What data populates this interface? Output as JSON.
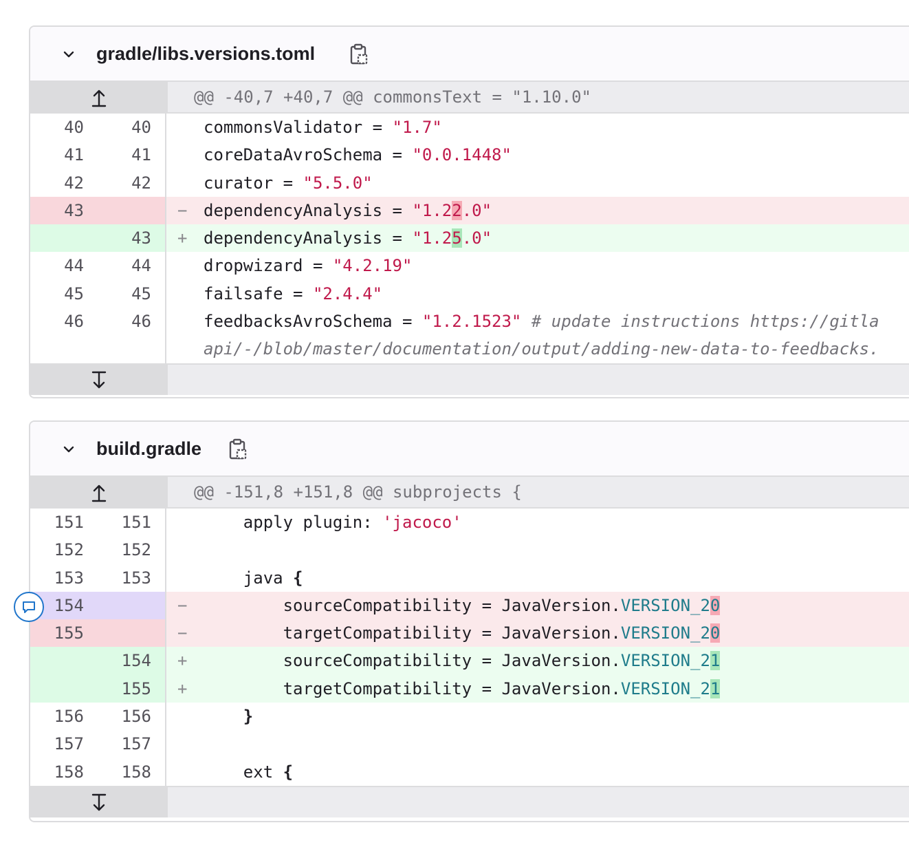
{
  "files": [
    {
      "path": "gradle/libs.versions.toml",
      "hunk_header": "@@ -40,7 +40,7 @@ commonsText = \"1.10.0\"",
      "lines": [
        {
          "old": "40",
          "new": "40",
          "sign": "",
          "key": "commonsValidator = ",
          "val": "\"1.7\""
        },
        {
          "old": "41",
          "new": "41",
          "sign": "",
          "key": "coreDataAvroSchema = ",
          "val": "\"0.0.1448\""
        },
        {
          "old": "42",
          "new": "42",
          "sign": "",
          "key": "curator = ",
          "val": "\"5.5.0\""
        },
        {
          "old": "43",
          "new": "",
          "sign": "−",
          "key": "dependencyAnalysis = ",
          "val_a": "\"1.2",
          "val_hl": "2",
          "val_b": ".0\""
        },
        {
          "old": "",
          "new": "43",
          "sign": "+",
          "key": "dependencyAnalysis = ",
          "val_a": "\"1.2",
          "val_hl": "5",
          "val_b": ".0\""
        },
        {
          "old": "44",
          "new": "44",
          "sign": "",
          "key": "dropwizard = ",
          "val": "\"4.2.19\""
        },
        {
          "old": "45",
          "new": "45",
          "sign": "",
          "key": "failsafe = ",
          "val": "\"2.4.4\""
        },
        {
          "old": "46",
          "new": "46",
          "sign": "",
          "key": "feedbacksAvroSchema = ",
          "val": "\"1.2.1523\"",
          "comment": " # update instructions https://gitla",
          "wrap": "api/-/blob/master/documentation/output/adding-new-data-to-feedbacks."
        }
      ]
    },
    {
      "path": "build.gradle",
      "hunk_header": "@@ -151,8 +151,8 @@ subprojects {",
      "lines": [
        {
          "old": "151",
          "new": "151",
          "sign": "",
          "text": "    apply plugin: ",
          "str": "'jacoco'"
        },
        {
          "old": "152",
          "new": "152",
          "sign": "",
          "text": ""
        },
        {
          "old": "153",
          "new": "153",
          "sign": "",
          "text": "    java {"
        },
        {
          "old": "154",
          "new": "",
          "sign": "−",
          "text": "        sourceCompatibility = JavaVersion.",
          "cst": "VERSION_2",
          "hl": "0"
        },
        {
          "old": "155",
          "new": "",
          "sign": "−",
          "text": "        targetCompatibility = JavaVersion.",
          "cst": "VERSION_2",
          "hl": "0"
        },
        {
          "old": "",
          "new": "154",
          "sign": "+",
          "text": "        sourceCompatibility = JavaVersion.",
          "cst": "VERSION_2",
          "hl": "1"
        },
        {
          "old": "",
          "new": "155",
          "sign": "+",
          "text": "        targetCompatibility = JavaVersion.",
          "cst": "VERSION_2",
          "hl": "1"
        },
        {
          "old": "156",
          "new": "156",
          "sign": "",
          "text": "    }"
        },
        {
          "old": "157",
          "new": "157",
          "sign": "",
          "text": ""
        },
        {
          "old": "158",
          "new": "158",
          "sign": "",
          "text": "    ext {"
        }
      ]
    }
  ]
}
